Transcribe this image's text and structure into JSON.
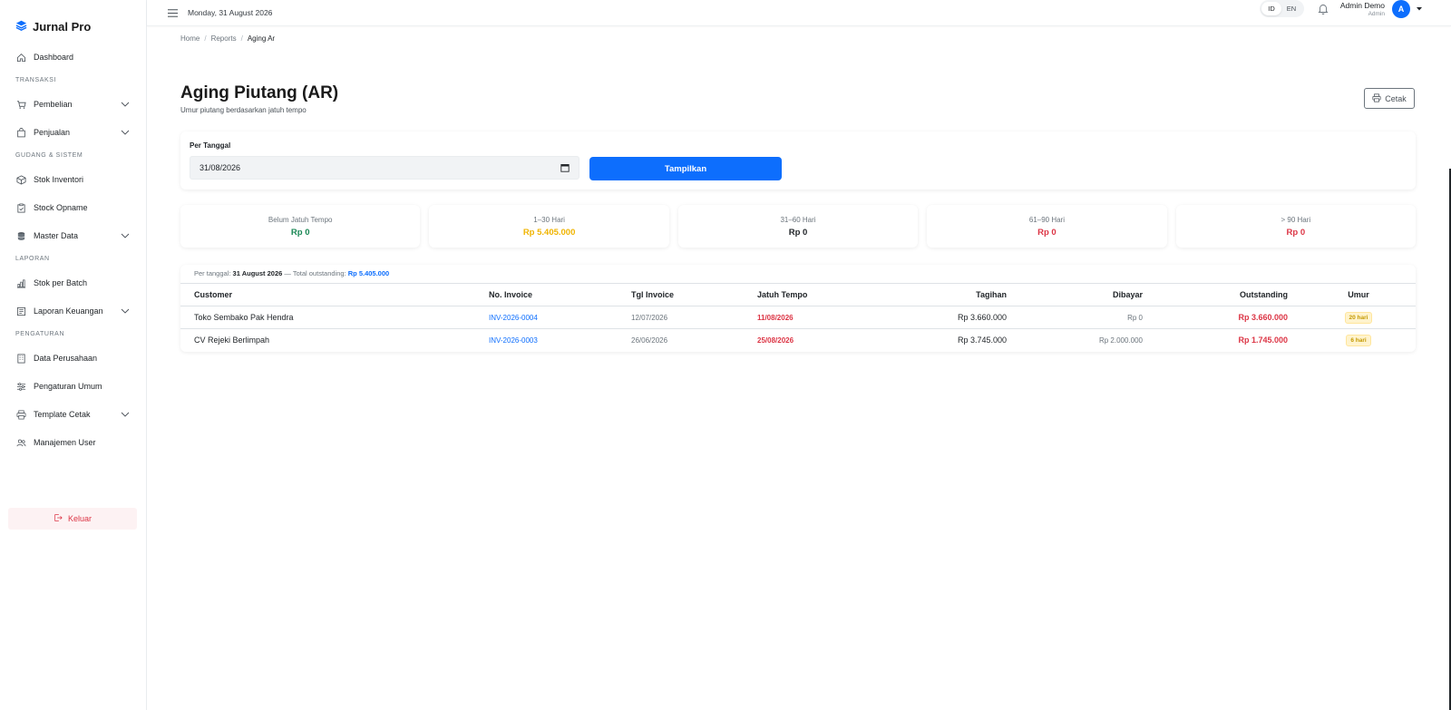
{
  "brand": {
    "name": "Jurnal Pro",
    "icon": "layers-icon",
    "color": "#0d6efd"
  },
  "sidebar": {
    "dashboard": "Dashboard",
    "sections": {
      "transaksi": "TRANSAKSI",
      "gudang": "GUDANG & SISTEM",
      "laporan": "LAPORAN",
      "pengaturan": "PENGATURAN"
    },
    "items": {
      "pembelian": "Pembelian",
      "penjualan": "Penjualan",
      "stok_inventori": "Stok Inventori",
      "stock_opname": "Stock Opname",
      "master_data": "Master Data",
      "stok_per_batch": "Stok per Batch",
      "laporan_keuangan": "Laporan Keuangan",
      "data_perusahaan": "Data Perusahaan",
      "pengaturan_umum": "Pengaturan Umum",
      "template_cetak": "Template Cetak",
      "manajemen_user": "Manajemen User"
    },
    "logout": "Keluar"
  },
  "topbar": {
    "date": "Monday, 31 August 2026",
    "lang_id": "ID",
    "lang_en": "EN",
    "user_name": "Admin Demo",
    "user_role": "Admin",
    "avatar_letter": "A"
  },
  "breadcrumb": {
    "home": "Home",
    "reports": "Reports",
    "current": "Aging Ar"
  },
  "page": {
    "title": "Aging Piutang (AR)",
    "subtitle": "Umur piutang berdasarkan jatuh tempo",
    "print": "Cetak"
  },
  "filter": {
    "label": "Per Tanggal",
    "date_value": "31/08/2026",
    "submit": "Tampilkan"
  },
  "buckets": [
    {
      "label": "Belum Jatuh Tempo",
      "value": "Rp 0",
      "color": "#198754"
    },
    {
      "label": "1–30 Hari",
      "value": "Rp 5.405.000",
      "color": "#f0b400"
    },
    {
      "label": "31–60 Hari",
      "value": "Rp 0",
      "color": "#212529"
    },
    {
      "label": "61–90 Hari",
      "value": "Rp 0",
      "color": "#dc3545"
    },
    {
      "label": "> 90 Hari",
      "value": "Rp 0",
      "color": "#dc3545"
    }
  ],
  "table": {
    "meta_prefix": "Per tanggal:",
    "meta_date": "31 August 2026",
    "meta_mid": "— Total outstanding:",
    "meta_total": "Rp 5.405.000",
    "headers": {
      "customer": "Customer",
      "no_invoice": "No. Invoice",
      "tgl_invoice": "Tgl Invoice",
      "jatuh_tempo": "Jatuh Tempo",
      "tagihan": "Tagihan",
      "dibayar": "Dibayar",
      "outstanding": "Outstanding",
      "umur": "Umur"
    },
    "rows": [
      {
        "customer": "Toko Sembako Pak Hendra",
        "invoice": "INV-2026-0004",
        "tgl": "12/07/2026",
        "due": "11/08/2026",
        "tagihan": "Rp 3.660.000",
        "dibayar": "Rp 0",
        "outstanding": "Rp 3.660.000",
        "umur": "20 hari"
      },
      {
        "customer": "CV Rejeki Berlimpah",
        "invoice": "INV-2026-0003",
        "tgl": "26/06/2026",
        "due": "25/08/2026",
        "tagihan": "Rp 3.745.000",
        "dibayar": "Rp 2.000.000",
        "outstanding": "Rp 1.745.000",
        "umur": "6 hari"
      }
    ]
  }
}
